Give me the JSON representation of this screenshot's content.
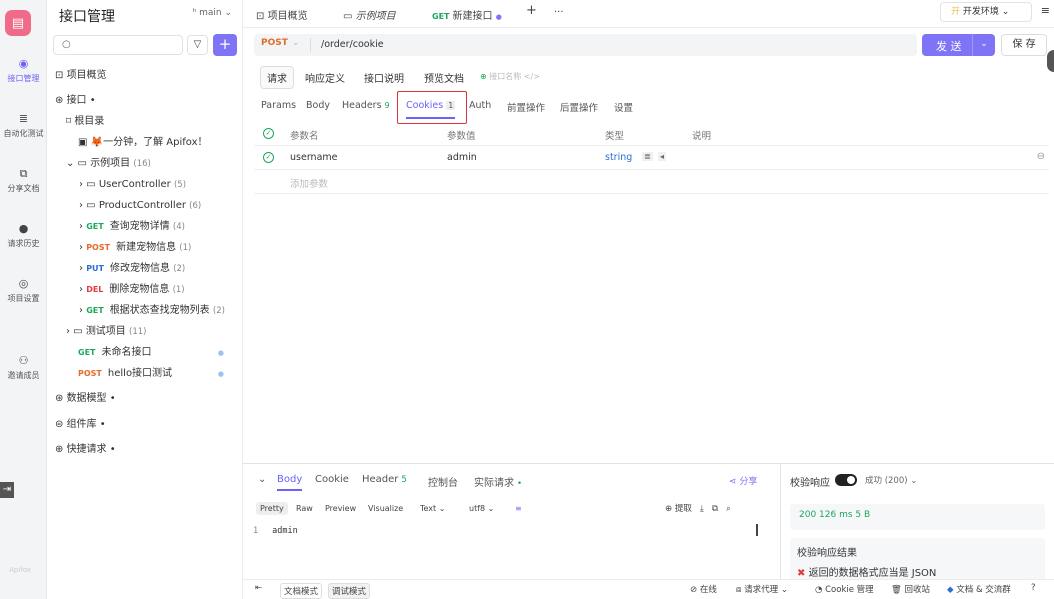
{
  "rail": {
    "items": [
      {
        "label": "接口管理",
        "icon": "api-icon"
      },
      {
        "label": "自动化测试",
        "icon": "test-icon"
      },
      {
        "label": "分享文档",
        "icon": "doc-icon"
      },
      {
        "label": "请求历史",
        "icon": "history-icon"
      },
      {
        "label": "项目设置",
        "icon": "settings-icon"
      },
      {
        "label": "邀请成员",
        "icon": "invite-icon"
      }
    ],
    "brand": "Apifox"
  },
  "sidebar": {
    "title": "接口管理",
    "branch": "main",
    "overview": "项目概览",
    "api_root": "接口",
    "root_dir": "根目录",
    "intro": "🦊一分钟，了解 Apifox！",
    "sample_project": "示例项目",
    "sample_count": "(16)",
    "folders": [
      {
        "label": "UserController",
        "count": "(5)"
      },
      {
        "label": "ProductController",
        "count": "(6)"
      }
    ],
    "endpoints": [
      {
        "method": "GET",
        "label": "查询宠物详情",
        "count": "(4)"
      },
      {
        "method": "POST",
        "label": "新建宠物信息",
        "count": "(1)"
      },
      {
        "method": "PUT",
        "label": "修改宠物信息",
        "count": "(2)"
      },
      {
        "method": "DEL",
        "label": "删除宠物信息",
        "count": "(1)"
      },
      {
        "method": "GET",
        "label": "根据状态查找宠物列表",
        "count": "(2)"
      }
    ],
    "test_project": "测试项目",
    "test_count": "(11)",
    "loose": [
      {
        "method": "GET",
        "label": "未命名接口"
      },
      {
        "method": "POST",
        "label": "hello接口测试"
      }
    ],
    "data_model": "数据模型",
    "components": "组件库",
    "quick_request": "快捷请求"
  },
  "tabs": {
    "overview": "项目概览",
    "sample": "示例项目",
    "active_method": "GET",
    "active_label": "新建接口",
    "add": "+",
    "more": "···",
    "env": "开发环境"
  },
  "request": {
    "method": "POST",
    "url": "/order/cookie",
    "send": "发 送",
    "save": "保 存"
  },
  "subtabs": {
    "request": "请求",
    "response_def": "响应定义",
    "api_desc": "接口说明",
    "preview": "预览文档",
    "name_placeholder": "接口名称 </>"
  },
  "param_tabs": [
    {
      "label": "Params",
      "count": ""
    },
    {
      "label": "Body",
      "count": ""
    },
    {
      "label": "Headers",
      "count": "9"
    },
    {
      "label": "Cookies",
      "count": "1"
    },
    {
      "label": "Auth",
      "count": ""
    },
    {
      "label": "前置操作",
      "count": ""
    },
    {
      "label": "后置操作",
      "count": ""
    },
    {
      "label": "设置",
      "count": ""
    }
  ],
  "param_table": {
    "headers": [
      "参数名",
      "参数值",
      "类型",
      "说明"
    ],
    "rows": [
      {
        "name": "username",
        "value": "admin",
        "type": "string"
      }
    ],
    "add_placeholder": "添加参数"
  },
  "response": {
    "tabs": [
      {
        "label": "Body",
        "count": ""
      },
      {
        "label": "Cookie",
        "count": ""
      },
      {
        "label": "Header",
        "count": "5"
      },
      {
        "label": "控制台",
        "count": ""
      },
      {
        "label": "实际请求",
        "count": "•"
      }
    ],
    "share": "分享",
    "view_modes": [
      "Pretty",
      "Raw",
      "Preview",
      "Visualize",
      "Text",
      "utf8"
    ],
    "extract": "提取",
    "line_no": "1",
    "body_text": "admin",
    "validate_label": "校验响应",
    "status_text": "成功 (200)",
    "summary": "200   126 ms   5 B",
    "result_title": "校验响应结果",
    "result_error": "返回的数据格式应当是 JSON"
  },
  "statusbar": {
    "doc_mode": "文档模式",
    "debug_mode": "调试模式",
    "online": "在线",
    "proxy": "请求代理",
    "cookie_mgr": "Cookie 管理",
    "recycle": "回收站",
    "community": "文档 & 交流群"
  }
}
